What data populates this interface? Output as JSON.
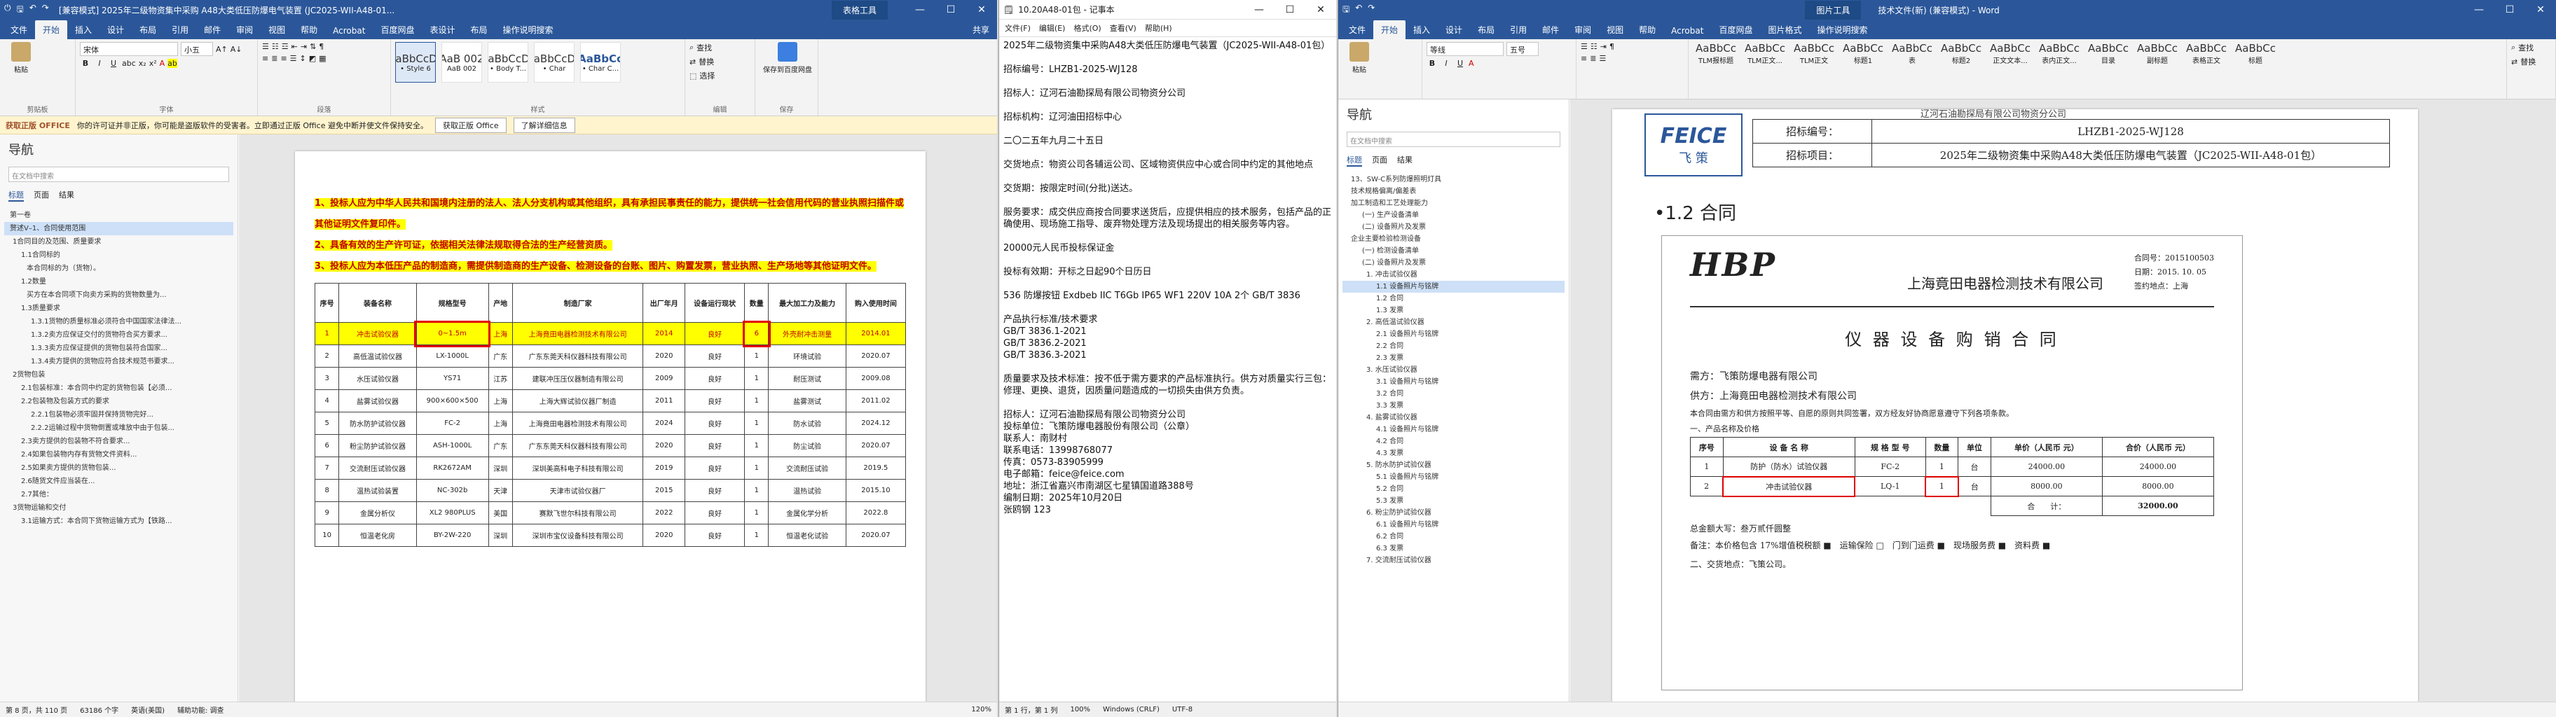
{
  "w1": {
    "title": "[兼容模式] 2025年二级物资集中采购 A48大类低压防爆电气装置 (JC2025-WII-A48-01...",
    "context_tab": "表格工具",
    "min": "—",
    "max": "☐",
    "close": "✕",
    "menu": [
      "文件",
      "开始",
      "插入",
      "设计",
      "布局",
      "引用",
      "邮件",
      "审阅",
      "视图",
      "帮助",
      "Acrobat",
      "百度网盘",
      "表设计",
      "布局"
    ],
    "search_help": "操作说明搜索",
    "share": "共享",
    "font_name": "宋体",
    "font_size": "小五",
    "styles": [
      {
        "p": "AaBbCcDc",
        "n": "• Style 6"
      },
      {
        "p": "AaB 002",
        "n": "AaB 002"
      },
      {
        "p": "AaBbCcDc",
        "n": "• Body T..."
      },
      {
        "p": "AaBbCcDd",
        "n": "• Char"
      },
      {
        "p": "AaBbCc",
        "n": "• Char C..."
      }
    ],
    "groups": [
      "剪贴板",
      "字体",
      "段落",
      "样式",
      "编辑",
      "保存"
    ],
    "paste": "粘贴",
    "find": "查找",
    "replace": "替换",
    "select": "选择",
    "save_baidu": "保存到百度网盘",
    "notice_title": "获取正版 OFFICE",
    "notice_text": "你的许可证并非正版，你可能是盗版软件的受害者。立即通过正版 Office 避免中断并使文件保持安全。",
    "notice_btn1": "获取正版 Office",
    "notice_btn2": "了解详细信息",
    "nav_title": "导航",
    "nav_search": "在文档中搜索",
    "nav_tabs": [
      "标题",
      "页面",
      "结果"
    ],
    "nav_items": [
      "第一卷",
      "赘述V–1、合同使用范围",
      "1合同目的及范围、质量要求",
      "1.1合同标的",
      "本合同标的为（货物）。",
      "1.2数量",
      "买方在本合同项下向卖方采购的货物数量为...",
      "1.3质量要求",
      "1.3.1货物的质量标准必须符合中国国家法律法...",
      "1.3.2卖方应保证交付的货物符合买方要求...",
      "1.3.3卖方应保证提供的货物包装符合国家...",
      "1.3.4卖方提供的货物应符合技术规范书要求...",
      "2货物包装",
      "2.1包装标准：本合同中约定的货物包装【必须...",
      "2.2包装物及包装方式的要求",
      "2.2.1包装物必须牢固并保持货物完好...",
      "2.2.2运输过程中货物倒置或堆放中由于包装...",
      "2.3卖方提供的包装物不符合要求...",
      "2.4如果包装物内存有货物文件资料...",
      "2.5如果卖方提供的货物包装...",
      "2.6随货文件应当装在...",
      "2.7其他：",
      "3货物运输和交付",
      "3.1运输方式：本合同下货物运输方式为【铁路..."
    ],
    "nav_selected": 1,
    "req1": "1、投标人应为中华人民共和国境内注册的法人、法人分支机构或其他组织，具有承担民事责任的能力，提供统一社会信用代码的营业执照扫描件或其他证明文件复印件。",
    "req2": "2、具备有效的生产许可证，依据相关法律法规取得合法的生产经营资质。",
    "req3": "3、投标人应为本低压产品的制造商，需提供制造商的生产设备、检测设备的台账、图片、购置发票，营业执照、生产场地等其他证明文件。",
    "table_headers": [
      "序号",
      "装备名称",
      "规格型号",
      "产地",
      "制造厂家",
      "出厂年月",
      "设备运行现状",
      "数量",
      "最大加工力及能力",
      "购入使用时间"
    ],
    "table_rows": [
      [
        "1",
        "冲击试验仪器",
        "0~1.5m",
        "上海",
        "上海竟田电器检测技术有限公司",
        "2014",
        "良好",
        "6",
        "外壳耐冲击测量",
        "2014.01"
      ],
      [
        "2",
        "高低温试验仪器",
        "LX-1000L",
        "广东",
        "广东东莞天科仪器科技有限公司",
        "2020",
        "良好",
        "1",
        "环境试验",
        "2020.07"
      ],
      [
        "3",
        "水压试验仪器",
        "YS71",
        "江苏",
        "建联冲压压仪器制造有限公司",
        "2009",
        "良好",
        "1",
        "耐压测试",
        "2009.08"
      ],
      [
        "4",
        "盐雾试验仪器",
        "900×600×500",
        "上海",
        "上海大辉试验仪器厂制造",
        "2011",
        "良好",
        "1",
        "盐雾测试",
        "2011.02"
      ],
      [
        "5",
        "防水防护试验仪器",
        "FC-2",
        "上海",
        "上海竟田电器检测技术有限公司",
        "2024",
        "良好",
        "1",
        "防水试验",
        "2024.12"
      ],
      [
        "6",
        "粉尘防护试验仪器",
        "ASH-1000L",
        "广东",
        "广东东莞天科仪器科技有限公司",
        "2020",
        "良好",
        "1",
        "防尘试验",
        "2020.07"
      ],
      [
        "7",
        "交流耐压试验仪器",
        "RK2672AM",
        "深圳",
        "深圳美高科电子科技有限公司",
        "2019",
        "良好",
        "1",
        "交流耐压试验",
        "2019.5"
      ],
      [
        "8",
        "温热试验装置",
        "NC-302b",
        "天津",
        "天津市试验仪器厂",
        "2015",
        "良好",
        "1",
        "温热试验",
        "2015.10"
      ],
      [
        "9",
        "金属分析仪",
        "XL2 980PLUS",
        "美国",
        "赛默飞世尔科技有限公司",
        "2022",
        "良好",
        "1",
        "金属化学分析",
        "2022.8"
      ],
      [
        "10",
        "恒温老化房",
        "BY-2W-220",
        "深圳",
        "深圳市宝仪设备科技有限公司",
        "2020",
        "良好",
        "1",
        "恒温老化试验",
        "2020.07"
      ]
    ],
    "status": [
      "第 8 页，共 110 页",
      "63186 个字",
      "英语(美国)",
      "辅助功能: 调查"
    ],
    "zoom": "120%"
  },
  "w2": {
    "title": "10.20A48-01包 - 记事本",
    "menu": [
      "文件(F)",
      "编辑(E)",
      "格式(O)",
      "查看(V)",
      "帮助(H)"
    ],
    "lines": [
      "2025年二级物资集中采购A48大类低压防爆电气装置（JC2025-WII-A48-01包）",
      "招标编号：LHZB1-2025-WJ128",
      "招标人：辽河石油勘探局有限公司物资分公司",
      "招标机构：辽河油田招标中心",
      "二〇二五年九月二十五日",
      "交货地点：物资公司各辅运公司、区域物资供应中心或合同中约定的其他地点",
      "交货期：按限定时间(分批)送达。",
      "服务要求：成交供应商按合同要求送货后，应提供相应的技术服务，包括产品的正确使用、现场施工指导、废弃物处理方法及现场提出的相关服务等内容。",
      "20000元人民币投标保证金",
      "投标有效期：开标之日起90个日历日",
      "536 防爆按钮 Exdbeb IIC T6Gb IP65 WF1 220V 10A 2个 GB/T 3836",
      "产品执行标准/技术要求\nGB/T 3836.1-2021\nGB/T 3836.2-2021\nGB/T 3836.3-2021",
      "质量要求及技术标准：按不低于需方要求的产品标准执行。供方对质量实行三包：修理、更换、退货，因质量问题造成的一切损失由供方负责。",
      "招标人：辽河石油勘探局有限公司物资分公司\n投标单位：飞策防爆电器股份有限公司（公章）\n联系人：南财村\n联系电话：13998768077\n传真：0573-83905999\n电子邮箱：feice@feice.com\n地址：浙江省嘉兴市南湖区七星镇国道路388号\n编制日期：2025年10月20日\n张鸥钢 123"
    ],
    "status": [
      "第 1 行，第 1 列",
      "100%",
      "Windows (CRLF)",
      "UTF-8"
    ]
  },
  "w3": {
    "title": "技术文件(新) (兼容模式) - Word",
    "context_tab": "图片工具",
    "menu": [
      "文件",
      "开始",
      "插入",
      "设计",
      "布局",
      "引用",
      "邮件",
      "审阅",
      "视图",
      "帮助",
      "Acrobat",
      "百度网盘",
      "图片格式"
    ],
    "search_help": "操作说明搜索",
    "font_name": "等线",
    "font_size": "五号",
    "styles": [
      "TLM报标题",
      "TLM正文...",
      "TLM正文",
      "标题1",
      "表",
      "标题2",
      "正文文本...",
      "表内正文...",
      "目录",
      "副标题",
      "表格正文",
      "标题"
    ],
    "nav_title": "导航",
    "nav_search": "在文档中搜索",
    "nav_tabs": [
      "标题",
      "页面",
      "结果"
    ],
    "nav_items": [
      "13、SW-C系列防爆照明灯具",
      "技术规格偏离/偏差表",
      "加工制造和工艺处理能力",
      "(一) 生产设备清单",
      "(二) 设备照片及发票",
      "企业主要检验检测设备",
      "(一) 检测设备清单",
      "(二) 设备照片及发票",
      "1. 冲击试验仪器",
      "1.1 设备照片与铭牌",
      "1.2 合同",
      "1.3 发票",
      "2. 高低温试验仪器",
      "2.1 设备照片与铭牌",
      "2.2 合同",
      "2.3 发票",
      "3. 水压试验仪器",
      "3.1 设备照片与铭牌",
      "3.2 合同",
      "3.3 发票",
      "4. 盐雾试验仪器",
      "4.1 设备照片与铭牌",
      "4.2 合同",
      "4.3 发票",
      "5. 防水防护试验仪器",
      "5.1 设备照片与铭牌",
      "5.2 合同",
      "5.3 发票",
      "6. 粉尘防护试验仪器",
      "6.1 设备照片与铭牌",
      "6.2 合同",
      "6.3 发票",
      "7. 交流耐压试验仪器"
    ],
    "nav_selected": 9,
    "hdr_rows": [
      [
        "招标编号：",
        "LHZB1-2025-WJ128"
      ],
      [
        "招标项目：",
        "2025年二级物资集中采购A48大类低压防爆电气装置（JC2025-WII-A48-01包）"
      ]
    ],
    "hdr_cut": "辽河石油勘探局有限公司物资分公司",
    "logo": "FEICE",
    "logo_cn": "飞 策",
    "heading": "•1.2 合同",
    "c_logo": "HBP",
    "c_company": "上海竟田电器检测技术有限公司",
    "c_no": "合同号：2015100503",
    "c_date": "日期：2015. 10. 05",
    "c_place": "签约地点：上海",
    "c_title": "仪 器 设 备 购 销 合 同",
    "c_buyer": "需方：飞策防爆电器有限公司",
    "c_seller": "供方：上海竟田电器检测技术有限公司",
    "c_intro": "本合同由需方和供方按照平等、自愿的原则共同签署，双方经友好协商愿意遵守下列各项条款。",
    "c_sec1": "一、产品名称及价格",
    "c_headers": [
      "序号",
      "设 备 名 称",
      "规 格 型 号",
      "数量",
      "单位",
      "单价（人民币 元）",
      "合价（人民币 元）"
    ],
    "c_rows": [
      [
        "1",
        "防护（防水）试验仪器",
        "FC-2",
        "1",
        "台",
        "24000.00",
        "24000.00"
      ],
      [
        "2",
        "冲击试验仪器",
        "LQ-1",
        "1",
        "台",
        "8000.00",
        "8000.00"
      ]
    ],
    "c_total_label": "合　　计：",
    "c_total": "32000.00",
    "c_amount": "总金额大写：叁万贰仟圆整",
    "c_note": "备注：本价格包含 17%增值税税额 ■　运输保险 □　门到门运费 ■　现场服务费 ■　资料费 ■",
    "c_sec2": "二、交货地点：飞策公司。"
  },
  "colors": {
    "word_blue": "#2b579a",
    "highlight": "#ffff00",
    "req_red": "#c00000",
    "box_red": "#e00000"
  }
}
